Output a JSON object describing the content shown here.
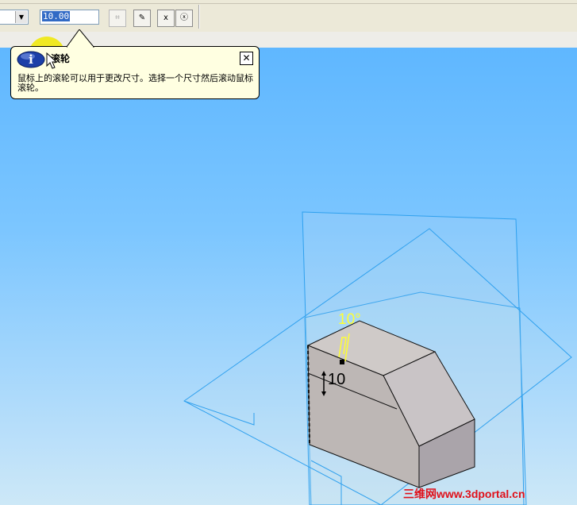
{
  "toolbar": {
    "dimension_value": "10.00",
    "buttons": [
      {
        "name": "dimension-options",
        "glyph": "⌗",
        "disabled": true
      },
      {
        "name": "edit",
        "glyph": "✎",
        "disabled": false
      },
      {
        "name": "cancel",
        "glyph": "x",
        "disabled": false
      },
      {
        "name": "close-sketch",
        "glyph": "ⓧ",
        "disabled": false
      }
    ]
  },
  "tooltip": {
    "title": "滚轮",
    "body": "鼠标上的滚轮可以用于更改尺寸。选择一个尺寸然后滚动鼠标滚轮。",
    "close_glyph": "✕",
    "icon": "info-icon"
  },
  "viewport": {
    "angle_dimension": "10°",
    "length_dimension": "10"
  },
  "watermark": "三维网www.3dportal.cn",
  "colors": {
    "toolbar_bg": "#ece9d8",
    "viewport_top": "#5fb7ff",
    "viewport_bottom": "#cde8f7",
    "tooltip_bg": "#ffffe1",
    "dimension_yellow": "#ffff33",
    "watermark_red": "#e0101a"
  }
}
